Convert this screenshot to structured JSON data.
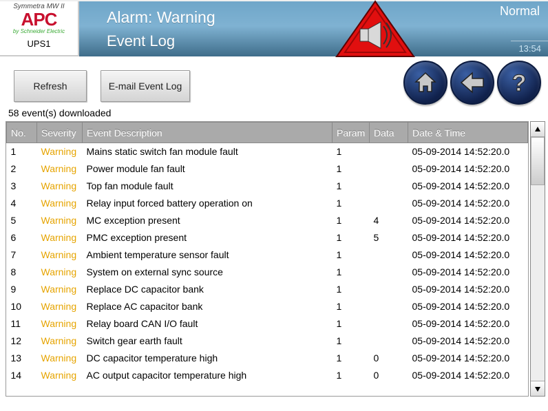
{
  "brand": {
    "top": "Symmetra MW II",
    "logo": "APC",
    "sub": "by Schneider Electric",
    "ups": "UPS1"
  },
  "header": {
    "title": "Alarm: Warning",
    "subtitle": "Event Log",
    "status": "Normal",
    "time": "13:54"
  },
  "toolbar": {
    "refresh": "Refresh",
    "email": "E-mail Event Log"
  },
  "count": "58 event(s) downloaded",
  "columns": {
    "no": "No.",
    "severity": "Severity",
    "desc": "Event Description",
    "param": "Param",
    "data": "Data",
    "dt": "Date & Time"
  },
  "events": [
    {
      "no": "1",
      "sev": "Warning",
      "desc": "Mains static switch fan module fault",
      "param": "1",
      "data": "",
      "dt": "05-09-2014 14:52:20.0"
    },
    {
      "no": "2",
      "sev": "Warning",
      "desc": "Power module fan fault",
      "param": "1",
      "data": "",
      "dt": "05-09-2014 14:52:20.0"
    },
    {
      "no": "3",
      "sev": "Warning",
      "desc": "Top fan module fault",
      "param": "1",
      "data": "",
      "dt": "05-09-2014 14:52:20.0"
    },
    {
      "no": "4",
      "sev": "Warning",
      "desc": "Relay input forced battery operation on",
      "param": "1",
      "data": "",
      "dt": "05-09-2014 14:52:20.0"
    },
    {
      "no": "5",
      "sev": "Warning",
      "desc": "MC exception present",
      "param": "1",
      "data": "4",
      "dt": "05-09-2014 14:52:20.0"
    },
    {
      "no": "6",
      "sev": "Warning",
      "desc": "PMC exception present",
      "param": "1",
      "data": "5",
      "dt": "05-09-2014 14:52:20.0"
    },
    {
      "no": "7",
      "sev": "Warning",
      "desc": "Ambient temperature sensor fault",
      "param": "1",
      "data": "",
      "dt": "05-09-2014 14:52:20.0"
    },
    {
      "no": "8",
      "sev": "Warning",
      "desc": "System on external sync source",
      "param": "1",
      "data": "",
      "dt": "05-09-2014 14:52:20.0"
    },
    {
      "no": "9",
      "sev": "Warning",
      "desc": "Replace DC capacitor bank",
      "param": "1",
      "data": "",
      "dt": "05-09-2014 14:52:20.0"
    },
    {
      "no": "10",
      "sev": "Warning",
      "desc": "Replace AC capacitor bank",
      "param": "1",
      "data": "",
      "dt": "05-09-2014 14:52:20.0"
    },
    {
      "no": "11",
      "sev": "Warning",
      "desc": "Relay board CAN I/O fault",
      "param": "1",
      "data": "",
      "dt": "05-09-2014 14:52:20.0"
    },
    {
      "no": "12",
      "sev": "Warning",
      "desc": "Switch gear earth fault",
      "param": "1",
      "data": "",
      "dt": "05-09-2014 14:52:20.0"
    },
    {
      "no": "13",
      "sev": "Warning",
      "desc": "DC capacitor temperature high",
      "param": "1",
      "data": "0",
      "dt": "05-09-2014 14:52:20.0"
    },
    {
      "no": "14",
      "sev": "Warning",
      "desc": "AC output capacitor temperature high",
      "param": "1",
      "data": "0",
      "dt": "05-09-2014 14:52:20.0"
    }
  ]
}
